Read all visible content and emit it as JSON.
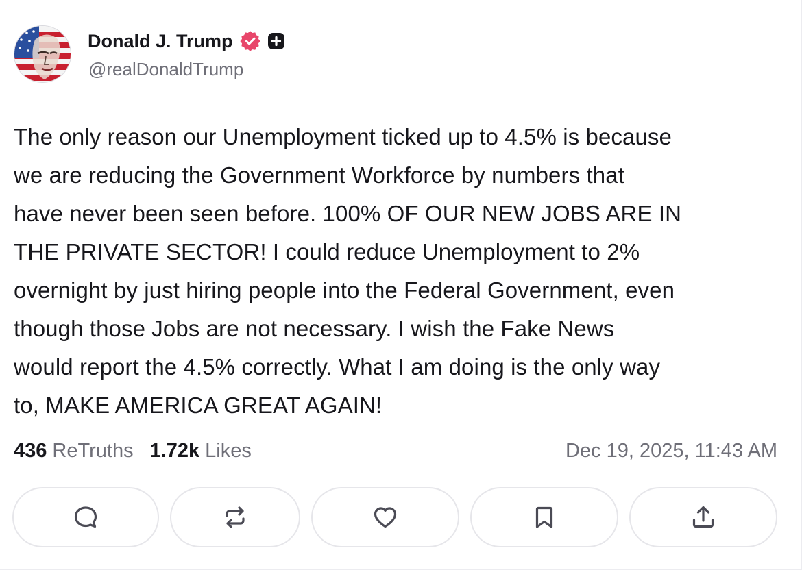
{
  "author": {
    "display_name": "Donald J. Trump",
    "handle": "@realDonaldTrump",
    "avatar_icon": "flag-portrait-avatar",
    "verified_icon": "verified-badge-icon",
    "verified_color": "#e8466a",
    "plus_icon": "plus-badge-icon"
  },
  "post": {
    "lines": [
      "The only reason our Unemployment ticked up to 4.5% is because",
      "we are reducing the Government Workforce by numbers that",
      "have never been seen before. 100% OF OUR NEW JOBS ARE IN",
      "THE PRIVATE SECTOR! I could reduce Unemployment to 2%",
      "overnight by just hiring people into the Federal Government, even",
      "though those Jobs are not necessary. I wish the Fake News",
      "would report the 4.5% correctly. What I am doing is the only way",
      "to, MAKE AMERICA GREAT AGAIN!"
    ]
  },
  "stats": {
    "retruths_count": "436",
    "retruths_label": "ReTruths",
    "likes_count": "1.72k",
    "likes_label": "Likes",
    "timestamp": "Dec 19, 2025, 11:43 AM"
  },
  "actions": [
    {
      "icon": "reply-icon"
    },
    {
      "icon": "retruth-icon"
    },
    {
      "icon": "like-heart-icon"
    },
    {
      "icon": "bookmark-icon"
    },
    {
      "icon": "share-icon"
    }
  ]
}
